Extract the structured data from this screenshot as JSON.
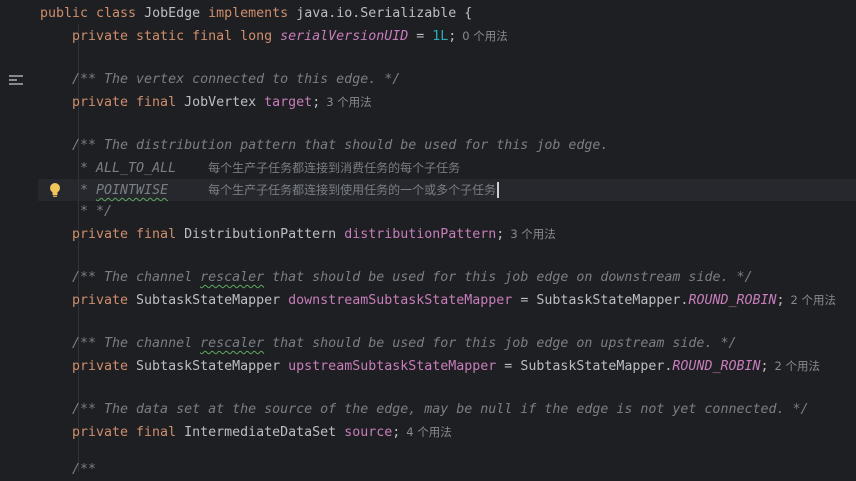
{
  "lines": {
    "l0": {
      "kw1": "public class ",
      "name": "JobEdge ",
      "kw2": "implements ",
      "rest": "java.io.Serializable {"
    },
    "l1": {
      "kw": "private static final long ",
      "field": "serialVersionUID",
      "eq": " = ",
      "num": "1L",
      ";": ";",
      "hint": "0 个用法"
    },
    "l3": {
      "comment": "/** The vertex connected to this edge. */"
    },
    "l4": {
      "kw": "private final ",
      "type": "JobVertex ",
      "field": "target",
      ";": ";",
      "hint": "3 个用法"
    },
    "l6": {
      "comment": "/** The distribution pattern that should be used for this job edge."
    },
    "l7": {
      "prefix": " * ",
      "item": "ALL_TO_ALL",
      "cn": "每个生产子任务都连接到消费任务的每个子任务"
    },
    "l8": {
      "prefix": " * ",
      "item": "POINTWISE",
      "cn": "每个生产子任务都连接到使用任务的一个或多个子任务"
    },
    "l9": {
      "comment": " * */"
    },
    "l10": {
      "kw": "private final ",
      "type": "DistributionPattern ",
      "field": "distributionPattern",
      ";": ";",
      "hint": "3 个用法"
    },
    "l12": {
      "c1": "/** The channel ",
      "wavy": "rescaler",
      "c2": " that should be used for this job edge on downstream side. */"
    },
    "l13": {
      "kw": "private ",
      "type": "SubtaskStateMapper ",
      "field": "downstreamSubtaskStateMapper",
      "eq": " = SubtaskStateMapper.",
      "const": "ROUND_ROBIN",
      ";": ";",
      "hint": "2 个用法"
    },
    "l15": {
      "c1": "/** The channel ",
      "wavy": "rescaler",
      "c2": " that should be used for this job edge on upstream side. */"
    },
    "l16": {
      "kw": "private ",
      "type": "SubtaskStateMapper ",
      "field": "upstreamSubtaskStateMapper",
      "eq": " = SubtaskStateMapper.",
      "const": "ROUND_ROBIN",
      ";": ";",
      "hint": "2 个用法"
    },
    "l18": {
      "comment": "/** The data set at the source of the edge, may be null if the edge is not yet connected. */"
    },
    "l19": {
      "kw": "private final ",
      "type": "IntermediateDataSet ",
      "field": "source",
      ";": ";",
      "hint": "4 个用法"
    },
    "l21": {
      "comment": "/**"
    }
  },
  "icons": {
    "gutter_fold": "doc-comment-toggle-icon",
    "bulb": "lightbulb-icon"
  },
  "colors": {
    "background": "#1e1f22",
    "keyword": "#cf8e6d",
    "comment": "#7a7e85",
    "field": "#c77dbb",
    "number": "#2aacb8",
    "text": "#bcbec4"
  }
}
